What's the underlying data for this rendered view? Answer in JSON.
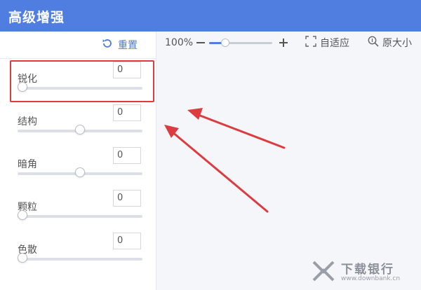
{
  "window": {
    "title": "高级增强"
  },
  "left_panel": {
    "reset_label": "重置",
    "controls": [
      {
        "label": "锐化",
        "value": "0",
        "slider": 0.0
      },
      {
        "label": "结构",
        "value": "0",
        "slider": 0.5
      },
      {
        "label": "暗角",
        "value": "0",
        "slider": 0.5
      },
      {
        "label": "颗粒",
        "value": "0",
        "slider": 0.0
      },
      {
        "label": "色散",
        "value": "0",
        "slider": 0.0
      }
    ]
  },
  "toolbar": {
    "zoom_value": "100%",
    "zoom_slider": 0.25,
    "fit_label": "自适应",
    "original_label": "原大小"
  },
  "watermark": {
    "name": "下载银行",
    "url": "www.downbank.cn"
  },
  "colors": {
    "accent": "#4f7de0",
    "highlight": "#e0393e",
    "annotation_arrow": "#dc3b3f"
  },
  "icons": {
    "reset": "refresh-icon",
    "zoom_out": "minus-icon",
    "zoom_in": "plus-icon",
    "fit": "fit-window-icon",
    "original": "magnifier-icon"
  }
}
